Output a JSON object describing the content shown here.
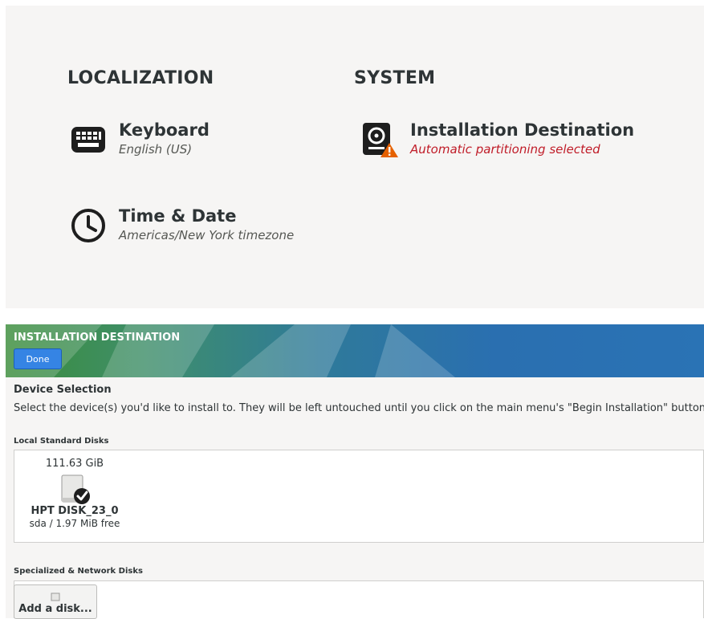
{
  "summary": {
    "localization_heading": "LOCALIZATION",
    "system_heading": "SYSTEM",
    "keyboard": {
      "title": "Keyboard",
      "status": "English (US)",
      "icon": "keyboard-icon"
    },
    "time_date": {
      "title": "Time & Date",
      "status": "Americas/New York timezone",
      "icon": "clock-icon"
    },
    "install_dest": {
      "title": "Installation Destination",
      "status": "Automatic partitioning selected",
      "icon": "harddisk-warning-icon"
    }
  },
  "install_destination": {
    "header_title": "INSTALLATION DESTINATION",
    "done_label": "Done",
    "device_selection_heading": "Device Selection",
    "device_selection_desc": "Select the device(s) you'd like to install to.  They will be left untouched until you click on the main menu's \"Begin Installation\" button.",
    "local_disks_heading": "Local Standard Disks",
    "disks": [
      {
        "size": "111.63 GiB",
        "name": "HPT DISK_23_0",
        "free": "sda  /  1.97 MiB free",
        "selected": true
      }
    ],
    "network_disks_heading": "Specialized & Network Disks",
    "add_disk_label": "Add a disk..."
  },
  "colors": {
    "warning": "#c01c28",
    "done_button": "#3584e4",
    "panel_bg": "#f6f5f4"
  }
}
